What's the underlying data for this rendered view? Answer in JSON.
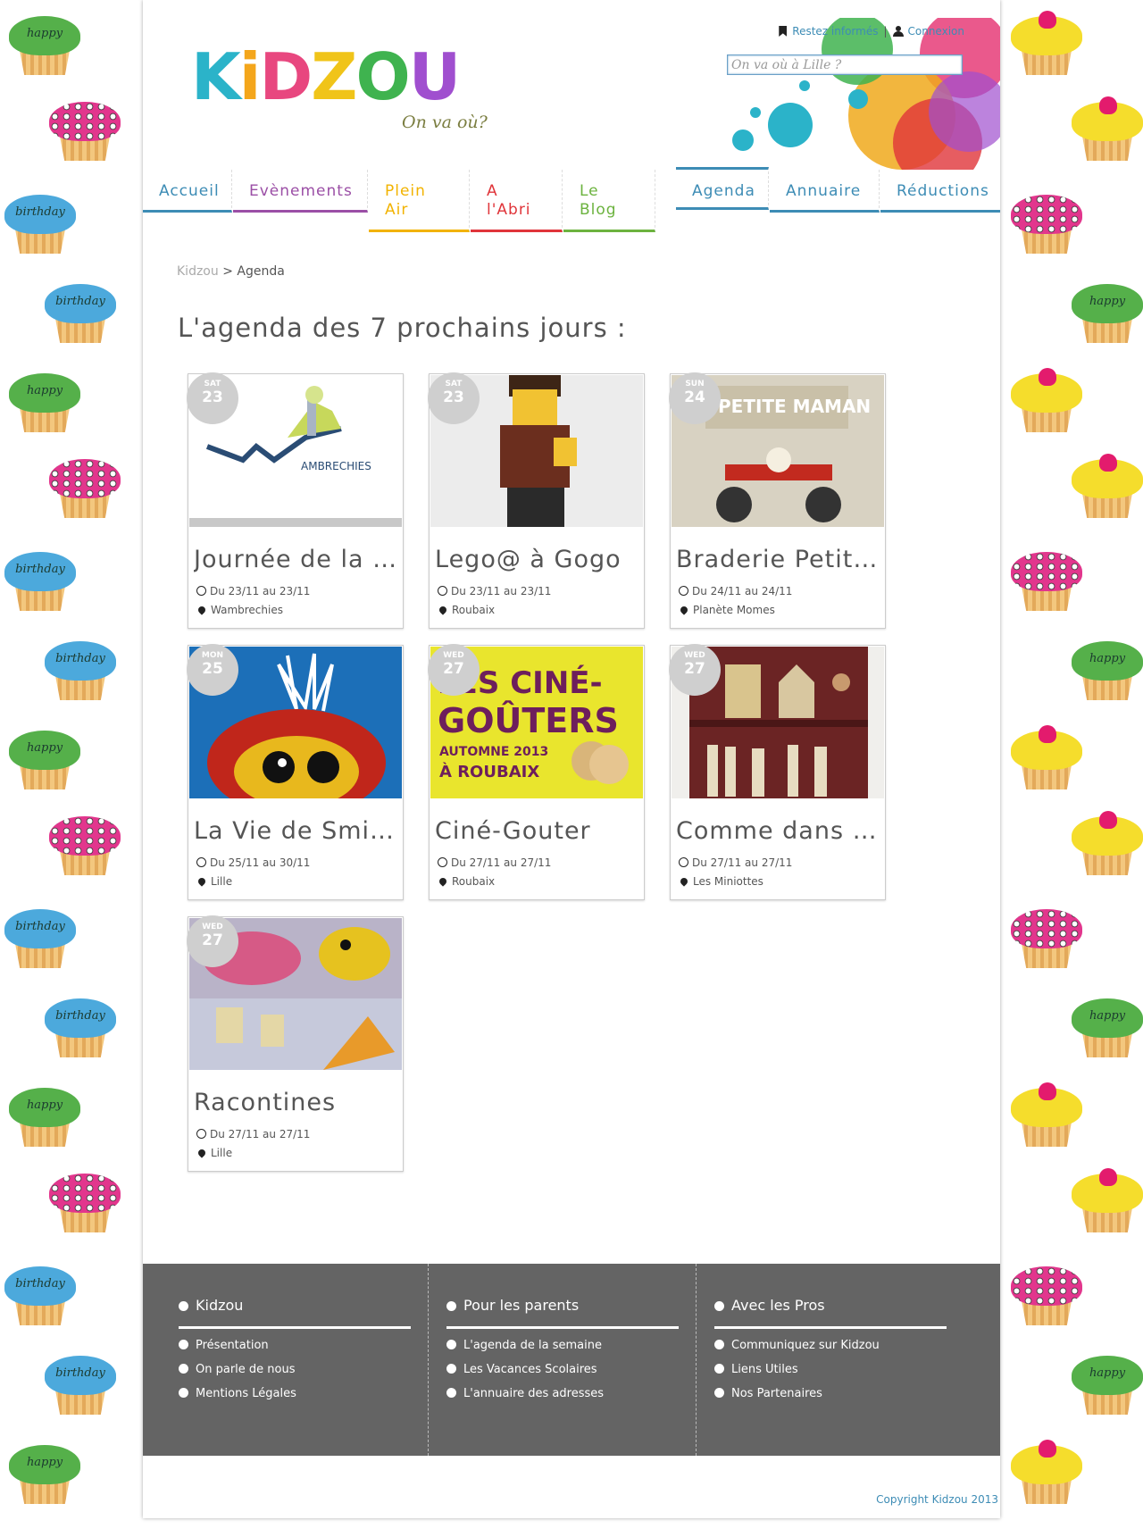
{
  "top_links": {
    "newsletter": "Restez informés",
    "separator": "|",
    "login": "Connexion"
  },
  "search": {
    "placeholder": "On va où à Lille ?"
  },
  "logo": {
    "letters": [
      "K",
      "i",
      "D",
      "Z",
      "O",
      "U"
    ],
    "tagline": "On va où?"
  },
  "nav": [
    {
      "label": "Accueil",
      "color": "#3d8cb5"
    },
    {
      "label": "Evènements",
      "color": "#9b4fa6"
    },
    {
      "label": "Plein Air",
      "color": "#f2b300"
    },
    {
      "label": "A l'Abri",
      "color": "#e0353a"
    },
    {
      "label": "Le Blog",
      "color": "#6cb33f"
    },
    {
      "label": "Agenda",
      "color": "#3d8cb5",
      "active": true
    },
    {
      "label": "Annuaire",
      "color": "#3d8cb5"
    },
    {
      "label": "Réductions",
      "color": "#3d8cb5"
    }
  ],
  "breadcrumb": {
    "home": "Kidzou",
    "sep": ">",
    "current": "Agenda"
  },
  "page_title": "L'agenda des 7 prochains jours :",
  "events": [
    {
      "day": "SAT",
      "num": "23",
      "title": "Journée de la ...",
      "dates": "Du 23/11 au 23/11",
      "place": "Wambrechies",
      "image": "ville-de-wambrechies-logo",
      "image_text": "AMBRECHIES"
    },
    {
      "day": "SAT",
      "num": "23",
      "title": "Lego@ à Gogo",
      "dates": "Du 23/11 au 23/11",
      "place": "Roubaix",
      "image": "lego-minifigure-photo"
    },
    {
      "day": "SUN",
      "num": "24",
      "title": "Braderie Petite...",
      "dates": "Du 24/11 au 24/11",
      "place": "Planète Momes",
      "image": "braderie-petite-maman-poster",
      "image_text": "PETITE MAMAN"
    },
    {
      "day": "MON",
      "num": "25",
      "title": "La Vie de Smis...",
      "dates": "Du 25/11 au 30/11",
      "place": "Lille",
      "image": "bird-puppet-photo"
    },
    {
      "day": "WED",
      "num": "27",
      "title": "Ciné-Gouter",
      "dates": "Du 27/11 au 27/11",
      "place": "Roubaix",
      "image": "cine-gouters-poster",
      "image_text": [
        "LES CINÉ-",
        "GOÛTERS",
        "AUTOMNE 2013",
        "À ROUBAIX"
      ]
    },
    {
      "day": "WED",
      "num": "27",
      "title": "Comme dans u...",
      "dates": "Du 27/11 au 27/11",
      "place": "Les Miniottes",
      "image": "miniature-shelf-photo"
    },
    {
      "day": "WED",
      "num": "27",
      "title": "Racontines",
      "dates": "Du 27/11 au 27/11",
      "place": "Lille",
      "image": "fabric-toys-photo"
    }
  ],
  "footer": {
    "columns": [
      {
        "heading": "Kidzou",
        "links": [
          "Présentation",
          "On parle de nous",
          "Mentions Légales"
        ]
      },
      {
        "heading": "Pour les parents",
        "links": [
          "L'agenda de la semaine",
          "Les Vacances Scolaires",
          "L'annuaire des adresses"
        ]
      },
      {
        "heading": "Avec les Pros",
        "links": [
          "Communiquez sur Kidzou",
          "Liens Utiles",
          "Nos Partenaires"
        ]
      }
    ],
    "copyright": "Copyright Kidzou 2013"
  },
  "colors": {
    "accent": "#3d8cb5",
    "footer_bg": "#646464",
    "date_badge": "#cfcfcf"
  }
}
